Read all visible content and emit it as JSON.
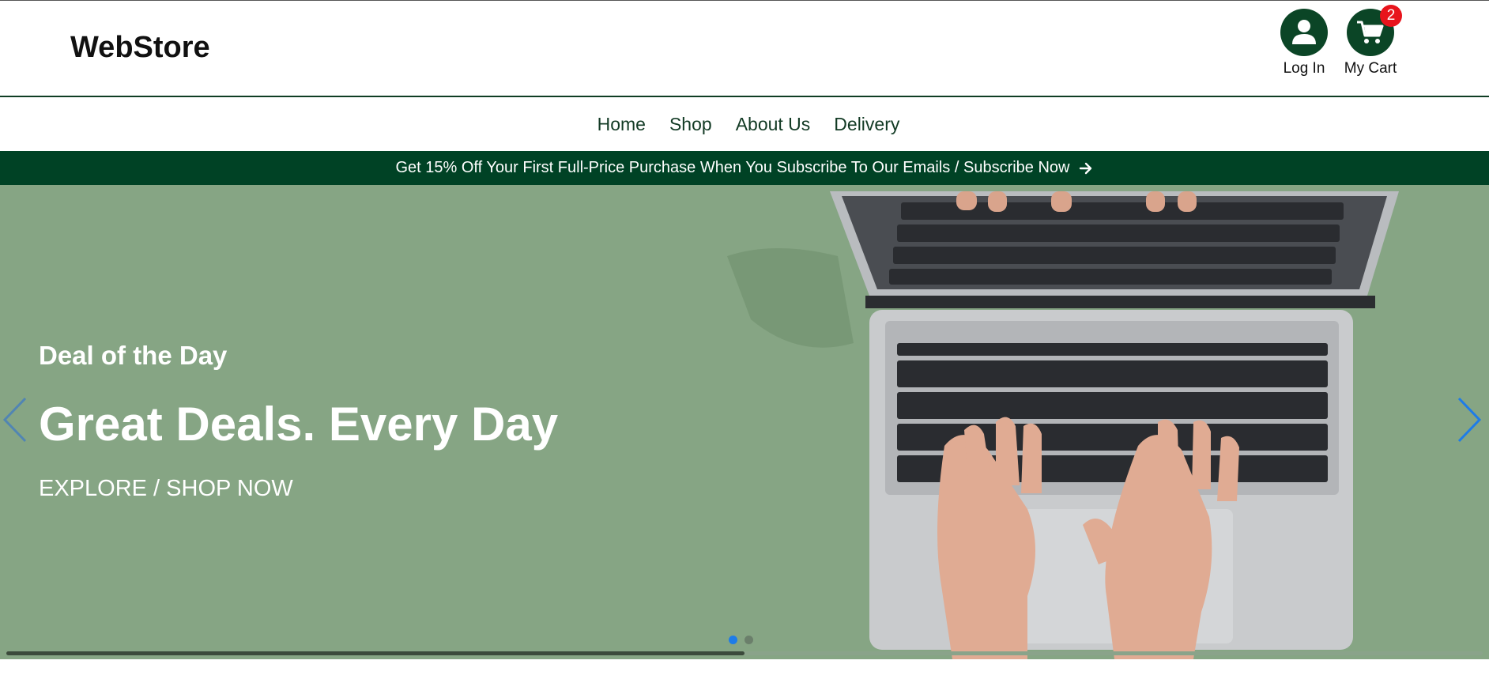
{
  "header": {
    "logo": "WebStore",
    "login_label": "Log In",
    "cart_label": "My Cart",
    "cart_count": "2",
    "accent_color": "#0b4526",
    "badge_color": "#e8141c"
  },
  "nav": {
    "items": [
      {
        "label": "Home"
      },
      {
        "label": "Shop"
      },
      {
        "label": "About Us"
      },
      {
        "label": "Delivery"
      }
    ]
  },
  "promo": {
    "text": "Get 15% Off Your First Full-Price Purchase When You Subscribe To Our Emails / Subscribe Now",
    "icon": "arrow-right-icon",
    "background": "#004225"
  },
  "hero": {
    "eyebrow": "Deal of the Day",
    "title": "Great Deals. Every Day",
    "cta": "EXPLORE / SHOP NOW",
    "background": "#86a584",
    "slide_count": 2,
    "active_slide": 1,
    "progress": 0.5
  }
}
